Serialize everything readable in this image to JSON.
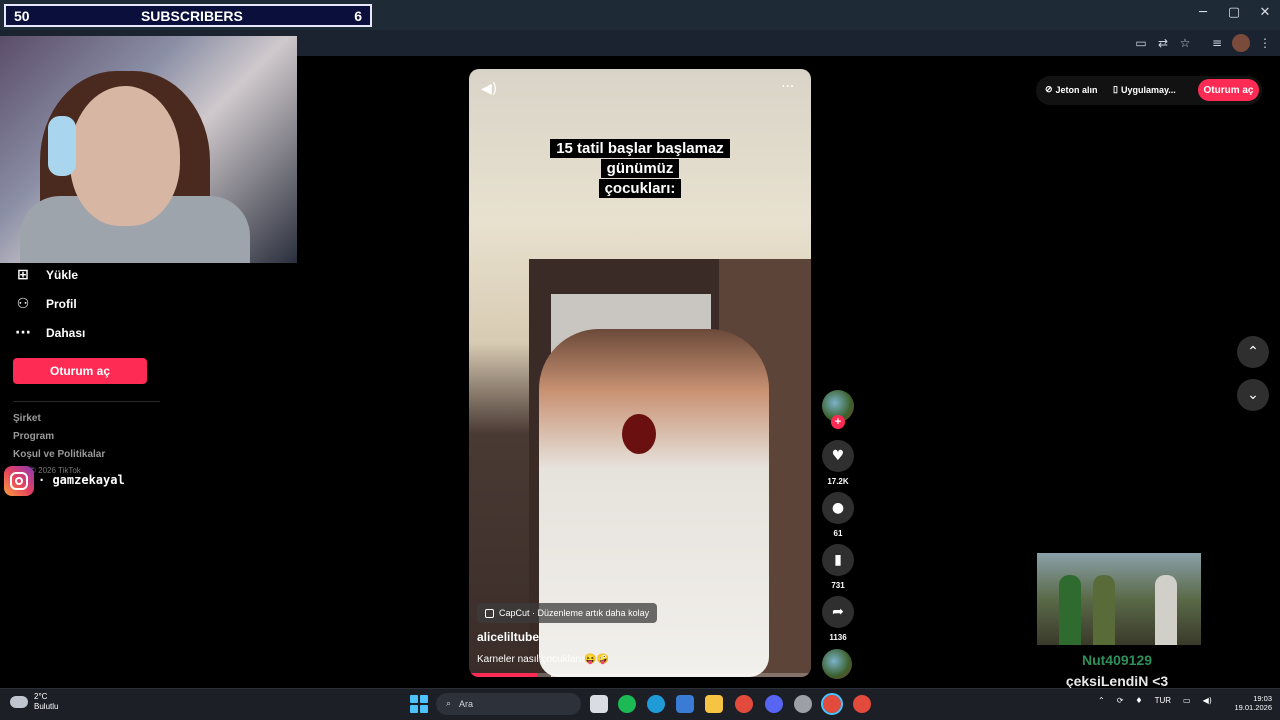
{
  "stream_overlay": {
    "sub_counter": {
      "left": "50",
      "label": "SUBSCRIBERS",
      "right": "6"
    },
    "instagram_handle": "· gamzekayal",
    "game_overlay_name": "Nut409129",
    "game_overlay_message": "çeksiLendiN <3"
  },
  "window_controls": {
    "minimize": "─",
    "maximize": "▢",
    "close": "✕"
  },
  "sidebar": {
    "items": [
      {
        "label": "Yükle",
        "icon": "upload-icon"
      },
      {
        "label": "Profil",
        "icon": "profile-icon"
      },
      {
        "label": "Dahası",
        "icon": "more-icon"
      }
    ],
    "login_button": "Oturum aç",
    "footer_links": [
      "Şirket",
      "Program",
      "Koşul ve Politikalar"
    ],
    "copyright": "© 2026 TikTok"
  },
  "video": {
    "caption_line1": "15 tatil başlar başlamaz günümüz",
    "caption_line2": "çocukları:",
    "capcut_tag": "CapCut · Düzenleme artık daha kolay",
    "author": "aliceliltube",
    "description": "Karneler nasıl çocuklarıı😝🤪",
    "progress": 0.2
  },
  "actions": {
    "likes": "17.2K",
    "comments": "61",
    "saves": "731",
    "shares": "1136"
  },
  "top_right": {
    "coins": "Jeton alın",
    "app": "Uygulamay...",
    "login": "Oturum aç"
  },
  "taskbar": {
    "temperature": "2°C",
    "weather": "Bulutlu",
    "search_placeholder": "Ara",
    "language": "TUR",
    "time": "19:03",
    "date": "19.01.2026"
  },
  "colors": {
    "accent": "#fe2c55",
    "taskbar": "#1c1f26"
  }
}
